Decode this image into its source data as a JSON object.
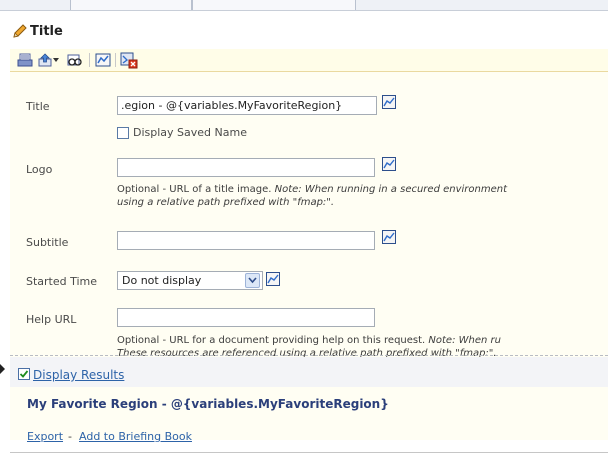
{
  "section": {
    "title": "Title"
  },
  "fields": {
    "title": {
      "label": "Title",
      "value": ".egion - @{variables.MyFavoriteRegion}"
    },
    "display_saved_name": {
      "label": "Display Saved Name",
      "checked": false
    },
    "logo": {
      "label": "Logo",
      "value": "",
      "help_plain": "Optional - URL of a title image. ",
      "help_italic_1": "Note: When running in a secured environment",
      "help_italic_2": "using a relative path prefixed with \"fmap:\"."
    },
    "subtitle": {
      "label": "Subtitle",
      "value": ""
    },
    "started_time": {
      "label": "Started Time",
      "selected": "Do not display"
    },
    "help_url": {
      "label": "Help URL",
      "value": "",
      "help_plain": "Optional - URL for a document providing help on this request. ",
      "help_italic_1": "Note: When ru",
      "help_italic_2": "These resources are referenced using a relative path prefixed with \"fmap:\"."
    }
  },
  "results": {
    "display_results_label": "Display Results",
    "display_results_checked": true,
    "title": "My Favorite Region - @{variables.MyFavoriteRegion}",
    "export_label": "Export",
    "separator": "-",
    "briefing_label": "Add to Briefing Book"
  },
  "icons": [
    "pencil-icon",
    "print-icon",
    "export-icon",
    "dropdown-arrow-icon",
    "preview-icon",
    "insert-variable-icon",
    "remove-variable-icon",
    "variable-icon",
    "checkmark-icon",
    "handle-icon"
  ],
  "colors": {
    "accent": "#2d63a8",
    "toolbar_bg": "#fffde8",
    "form_bg": "#fffef3",
    "result_title": "#2b3f7a"
  }
}
